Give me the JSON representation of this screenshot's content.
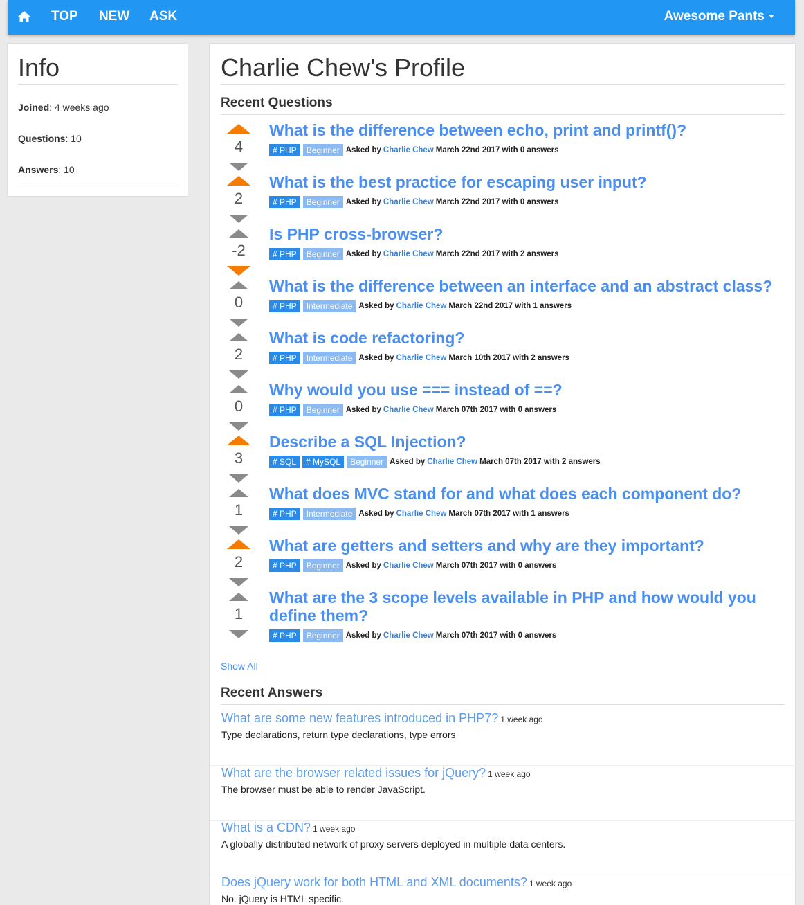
{
  "nav": {
    "links": [
      "TOP",
      "NEW",
      "ASK"
    ],
    "user": "Awesome Pants"
  },
  "info": {
    "title": "Info",
    "rows": [
      {
        "label": "Joined",
        "value": "4 weeks ago"
      },
      {
        "label": "Questions",
        "value": "10"
      },
      {
        "label": "Answers",
        "value": "10"
      }
    ]
  },
  "profile": {
    "title": "Charlie Chew's Profile",
    "recent_questions_heading": "Recent Questions",
    "recent_answers_heading": "Recent Answers",
    "show_all": "Show All",
    "asked_by": "Asked by",
    "with_prefix": "with",
    "answers_suffix": "answers"
  },
  "questions": [
    {
      "title": "What is the difference between echo, print and printf()?",
      "votes": "4",
      "vote_state": "up",
      "tags": [
        "PHP"
      ],
      "level": "Beginner",
      "author": "Charlie Chew",
      "date": "March 22nd 2017",
      "answers": "0"
    },
    {
      "title": "What is the best practice for escaping user input?",
      "votes": "2",
      "vote_state": "up",
      "tags": [
        "PHP"
      ],
      "level": "Beginner",
      "author": "Charlie Chew",
      "date": "March 22nd 2017",
      "answers": "0"
    },
    {
      "title": "Is PHP cross-browser?",
      "votes": "-2",
      "vote_state": "down",
      "tags": [
        "PHP"
      ],
      "level": "Beginner",
      "author": "Charlie Chew",
      "date": "March 22nd 2017",
      "answers": "2"
    },
    {
      "title": "What is the difference between an interface and an abstract class?",
      "votes": "0",
      "vote_state": "none",
      "tags": [
        "PHP"
      ],
      "level": "Intermediate",
      "author": "Charlie Chew",
      "date": "March 22nd 2017",
      "answers": "1"
    },
    {
      "title": "What is code refactoring?",
      "votes": "2",
      "vote_state": "none",
      "tags": [
        "PHP"
      ],
      "level": "Intermediate",
      "author": "Charlie Chew",
      "date": "March 10th 2017",
      "answers": "2"
    },
    {
      "title": "Why would you use === instead of ==?",
      "votes": "0",
      "vote_state": "none",
      "tags": [
        "PHP"
      ],
      "level": "Beginner",
      "author": "Charlie Chew",
      "date": "March 07th 2017",
      "answers": "0"
    },
    {
      "title": "Describe a SQL Injection?",
      "votes": "3",
      "vote_state": "up",
      "tags": [
        "SQL",
        "MySQL"
      ],
      "level": "Beginner",
      "author": "Charlie Chew",
      "date": "March 07th 2017",
      "answers": "2"
    },
    {
      "title": "What does MVC stand for and what does each component do?",
      "votes": "1",
      "vote_state": "none",
      "tags": [
        "PHP"
      ],
      "level": "Intermediate",
      "author": "Charlie Chew",
      "date": "March 07th 2017",
      "answers": "1"
    },
    {
      "title": "What are getters and setters and why are they important?",
      "votes": "2",
      "vote_state": "up",
      "tags": [
        "PHP"
      ],
      "level": "Beginner",
      "author": "Charlie Chew",
      "date": "March 07th 2017",
      "answers": "0"
    },
    {
      "title": "What are the 3 scope levels available in PHP and how would you define them?",
      "votes": "1",
      "vote_state": "none",
      "tags": [
        "PHP"
      ],
      "level": "Beginner",
      "author": "Charlie Chew",
      "date": "March 07th 2017",
      "answers": "0"
    }
  ],
  "answers": [
    {
      "question": "What are some new features introduced in PHP7?",
      "time": "1 week ago",
      "text": "Type declarations, return type declarations, type errors"
    },
    {
      "question": "What are the browser related issues for jQuery?",
      "time": "1 week ago",
      "text": "The browser must be able to render JavaScript."
    },
    {
      "question": "What is a CDN?",
      "time": "1 week ago",
      "text": "A globally distributed network of proxy servers deployed in multiple data centers."
    },
    {
      "question": "Does jQuery work for both HTML and XML documents?",
      "time": "1 week ago",
      "text": "No. jQuery is HTML specific."
    }
  ],
  "colors": {
    "navbar": "#2196f3",
    "link": "#4a8ff0",
    "tag": "#2a8ae8",
    "level_tag": "#8bbaf2",
    "vote_active": "#f57c00",
    "vote_idle": "#8a8a8a"
  },
  "icons": {
    "home": "home-icon",
    "tag": "hashtag-icon",
    "user_menu": "caret-down-icon"
  }
}
